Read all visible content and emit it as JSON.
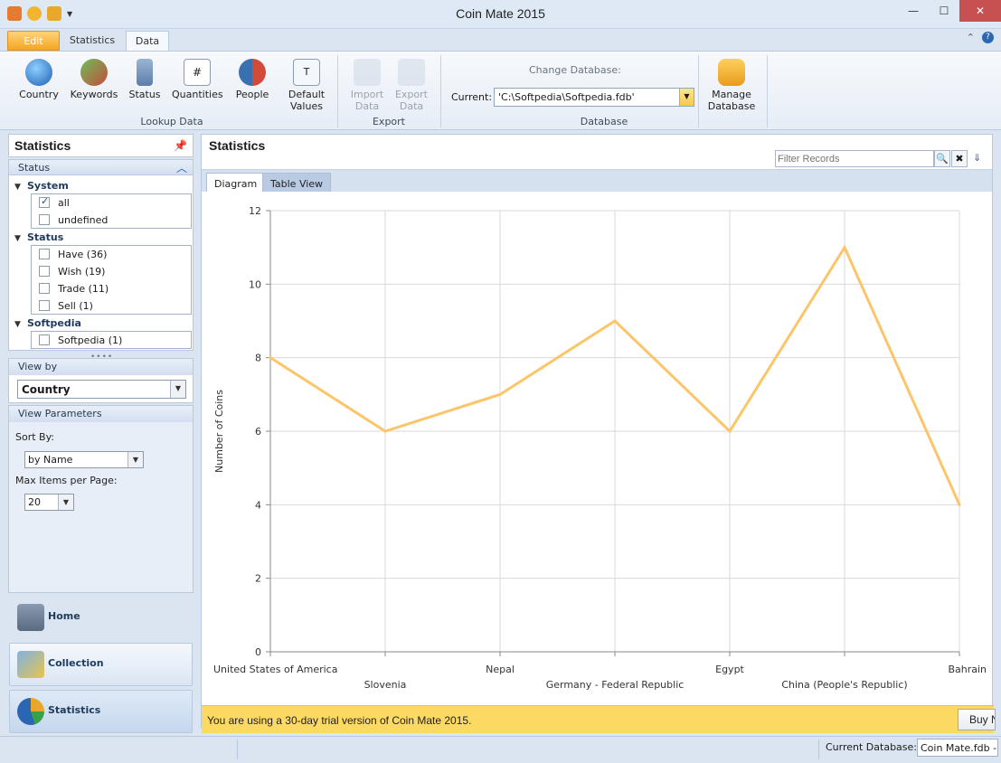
{
  "window": {
    "title": "Coin Mate 2015"
  },
  "ribbon_tabs": {
    "edit": "Edit",
    "statistics": "Statistics",
    "data": "Data"
  },
  "ribbon": {
    "lookup": {
      "country": "Country",
      "keywords": "Keywords",
      "status": "Status",
      "quantities": "Quantities",
      "people": "People",
      "default_values_1": "Default",
      "default_values_2": "Values",
      "group_label": "Lookup Data"
    },
    "export": {
      "import_1": "Import",
      "import_2": "Data",
      "export_1": "Export",
      "export_2": "Data",
      "group_label": "Export"
    },
    "database": {
      "change_label": "Change Database:",
      "current_label": "Current:",
      "current_value": "'C:\\Softpedia\\Softpedia.fdb'",
      "manage_1": "Manage",
      "manage_2": "Database",
      "group_label": "Database"
    }
  },
  "left_panel": {
    "title": "Statistics",
    "status_section": "Status",
    "groups": {
      "system": {
        "label": "System",
        "items": [
          "all",
          "undefined"
        ]
      },
      "status": {
        "label": "Status",
        "items": [
          "Have (36)",
          "Wish (19)",
          "Trade (11)",
          "Sell (1)"
        ]
      },
      "softpedia": {
        "label": "Softpedia",
        "items": [
          "Softpedia (1)"
        ]
      }
    },
    "view_by": {
      "label": "View by",
      "value": "Country"
    },
    "view_params": {
      "label": "View Parameters",
      "sort_by_label": "Sort By:",
      "sort_by_value": "by Name",
      "max_items_label": "Max Items per Page:",
      "max_items_value": "20"
    },
    "nav": {
      "home": "Home",
      "collection": "Collection",
      "statistics": "Statistics"
    }
  },
  "main": {
    "title": "Statistics",
    "filter_placeholder": "Filter Records",
    "tabs": {
      "diagram": "Diagram",
      "table_view": "Table View"
    }
  },
  "chart_data": {
    "type": "line",
    "categories": [
      "United States of America",
      "Slovenia",
      "Nepal",
      "Germany - Federal Republic",
      "Egypt",
      "China (People's Republic)",
      "Bahrain"
    ],
    "series": [
      {
        "values": [
          8,
          6,
          7,
          9,
          6,
          11,
          4
        ],
        "color": "#fcc56a"
      }
    ],
    "ylabel": "Number of Coins",
    "xlabel": "",
    "ylim": [
      0,
      12
    ],
    "yticks": [
      0,
      2,
      4,
      6,
      8,
      10,
      12
    ],
    "grid": true
  },
  "trial": {
    "message": "You are using a 30-day trial version of Coin Mate 2015.",
    "buy_label": "Buy Now"
  },
  "statusbar": {
    "current_db_label": "Current Database:",
    "current_db_value": "Coin Mate.fdb - Softpedia"
  }
}
